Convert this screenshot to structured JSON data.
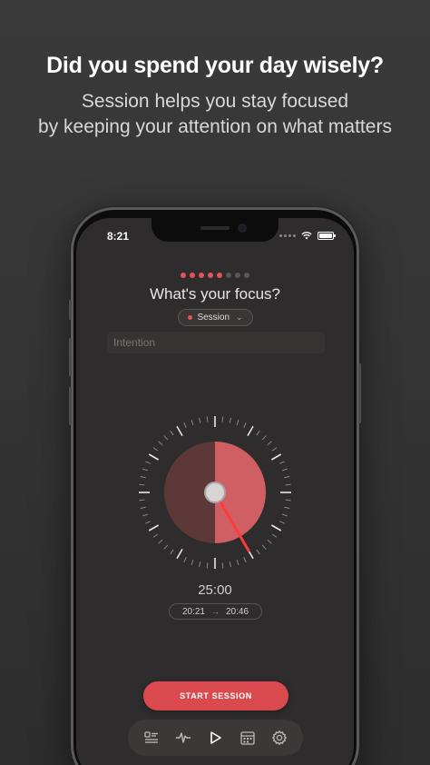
{
  "promo": {
    "headline": "Did you spend your day wisely?",
    "sub_line1": "Session helps you stay focused",
    "sub_line2": "by keeping your attention on what matters"
  },
  "status_bar": {
    "time": "8:21"
  },
  "progress": {
    "total_steps": 8,
    "completed_steps": 5,
    "accent": "#e0545a"
  },
  "focus": {
    "title": "What's your focus?",
    "category_label": "Session",
    "intention_placeholder": "Intention",
    "intention_value": ""
  },
  "timer": {
    "duration": "25:00",
    "start_time": "20:21",
    "end_time": "20:46",
    "elapsed_fraction": 0.5
  },
  "actions": {
    "start_label": "START SESSION"
  },
  "tabbar": {
    "items": [
      {
        "icon": "profile-list-icon"
      },
      {
        "icon": "pulse-icon"
      },
      {
        "icon": "play-icon"
      },
      {
        "icon": "calendar-icon"
      },
      {
        "icon": "gear-icon"
      }
    ]
  },
  "colors": {
    "accent": "#e0545a",
    "button": "#d9494d",
    "screen_bg": "#2e2c2c"
  }
}
